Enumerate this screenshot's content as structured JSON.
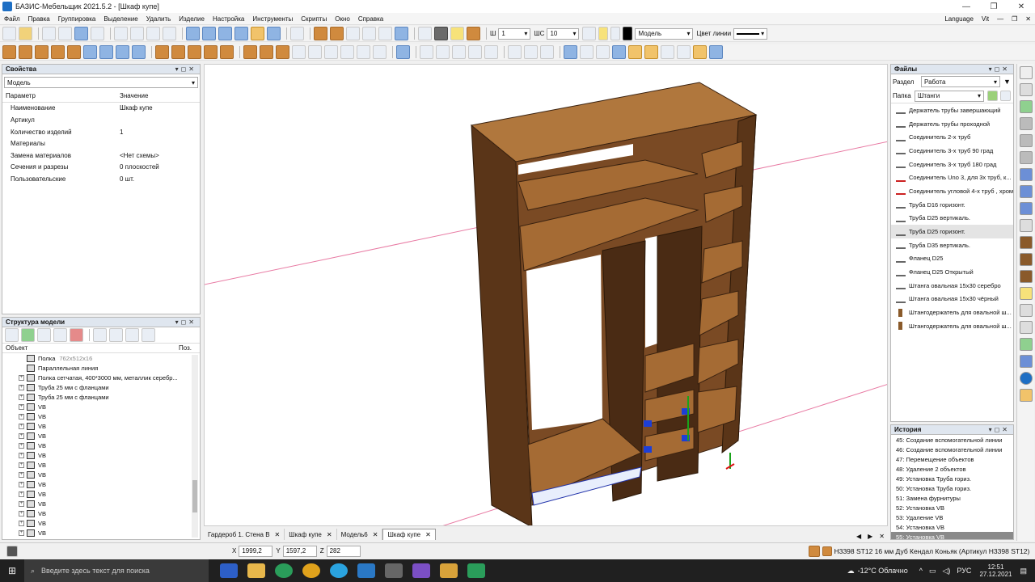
{
  "window": {
    "title": "БАЗИС-Мебельщик 2021.5.2 - [Шкаф купе]"
  },
  "menu": {
    "items": [
      "Файл",
      "Правка",
      "Группировка",
      "Выделение",
      "Удалить",
      "Изделие",
      "Настройка",
      "Инструменты",
      "Скрипты",
      "Окно",
      "Справка"
    ],
    "language": "Language",
    "user": "Vit"
  },
  "toolbar": {
    "sh_label": "Ш",
    "sh_value": "1",
    "shc_label": "ШС",
    "shc_value": "10",
    "model_value": "Модель",
    "line_color_label": "Цвет линии"
  },
  "properties": {
    "title": "Свойства",
    "mode": "Модель",
    "col_param": "Параметр",
    "col_value": "Значение",
    "rows": [
      {
        "p": "Наименование",
        "v": "Шкаф купе"
      },
      {
        "p": "Артикул",
        "v": ""
      },
      {
        "p": "Количество изделий",
        "v": "1"
      },
      {
        "p": "Материалы",
        "v": ""
      },
      {
        "p": "Замена материалов",
        "v": "<Нет схемы>"
      },
      {
        "p": "Сечения и разрезы",
        "v": "0 плоскостей"
      },
      {
        "p": "Пользовательские",
        "v": "0 шт."
      }
    ]
  },
  "structure": {
    "title": "Структура модели",
    "col_object": "Объект",
    "col_pos": "Поз.",
    "rows": [
      {
        "name": "Полка",
        "dim": "762x512x16",
        "plus": false
      },
      {
        "name": "Параллельная линия",
        "dim": "",
        "plus": false
      },
      {
        "name": "Полка сетчатая, 400*3000 мм, металлик серебр...",
        "dim": "",
        "plus": true
      },
      {
        "name": "Труба 25 мм с фланцами",
        "dim": "",
        "plus": true
      },
      {
        "name": "Труба 25 мм с фланцами",
        "dim": "",
        "plus": true
      },
      {
        "name": "VB",
        "dim": "",
        "plus": true
      },
      {
        "name": "VB",
        "dim": "",
        "plus": true
      },
      {
        "name": "VB",
        "dim": "",
        "plus": true
      },
      {
        "name": "VB",
        "dim": "",
        "plus": true
      },
      {
        "name": "VB",
        "dim": "",
        "plus": true
      },
      {
        "name": "VB",
        "dim": "",
        "plus": true
      },
      {
        "name": "VB",
        "dim": "",
        "plus": true
      },
      {
        "name": "VB",
        "dim": "",
        "plus": true
      },
      {
        "name": "VB",
        "dim": "",
        "plus": true
      },
      {
        "name": "VB",
        "dim": "",
        "plus": true
      },
      {
        "name": "VB",
        "dim": "",
        "plus": true
      },
      {
        "name": "VB",
        "dim": "",
        "plus": true
      },
      {
        "name": "VB",
        "dim": "",
        "plus": true
      },
      {
        "name": "VB",
        "dim": "",
        "plus": true
      }
    ]
  },
  "files": {
    "title": "Файлы",
    "section_label": "Раздел",
    "section_value": "Работа",
    "folder_label": "Папка",
    "folder_value": "Штанги",
    "items": [
      "Держатель трубы завершающий",
      "Держатель трубы проходной",
      "Соединитель 2-х труб",
      "Соединитель 3-х труб 90 град",
      "Соединитель 3-х труб 180 град",
      "Соединитель Uno 3, для 3х труб, к...",
      "Соединитель угловой 4-х труб , хром",
      "Труба D16 горизонт.",
      "Труба D25 вертикаль.",
      "Труба D25 горизонт.",
      "Труба D35 вертикаль.",
      "Фланец D25",
      "Фланец D25 Открытый",
      "Штанга овальная 15х30 серебро",
      "Штанга овальная 15х30 чёрный",
      "Штангодержатель для овальной ш...",
      "Штангодержатель для овальной ш..."
    ],
    "selected_index": 9
  },
  "history": {
    "title": "История",
    "items": [
      "45: Создание вспомогательной линии",
      "46: Создание вспомогательной линии",
      "47: Перемещение объектов",
      "48: Удаление 2 объектов",
      "49: Установка Труба гориз.",
      "50: Установка Труба гориз.",
      "51: Замена фурнитуры",
      "52: Установка VB",
      "53: Удаление VB",
      "54: Установка VB",
      "55: Установка VB"
    ],
    "selected_index": 10
  },
  "tabs": [
    "Гардероб 1. Стена В",
    "Шкаф купе",
    "Модель6",
    "Шкаф купе"
  ],
  "active_tab": 3,
  "status": {
    "x_label": "X",
    "x": "1999,2",
    "y_label": "Y",
    "y": "1597,2",
    "z_label": "Z",
    "z": "282",
    "material": "H3398 ST12 16 мм Дуб Кендал Коньяк (Артикул H3398 ST12)"
  },
  "taskbar": {
    "search_placeholder": "Введите здесь текст для поиска",
    "weather": "-12°C Облачно",
    "lang": "РУС",
    "time": "12:51",
    "date": "27.12.2021"
  },
  "colors": {
    "wood": "#7a4a24",
    "wood_light": "#b0773d",
    "wood_dark": "#4a2b14",
    "accent": "#1e6fc4",
    "guide": "#e87aa3"
  }
}
